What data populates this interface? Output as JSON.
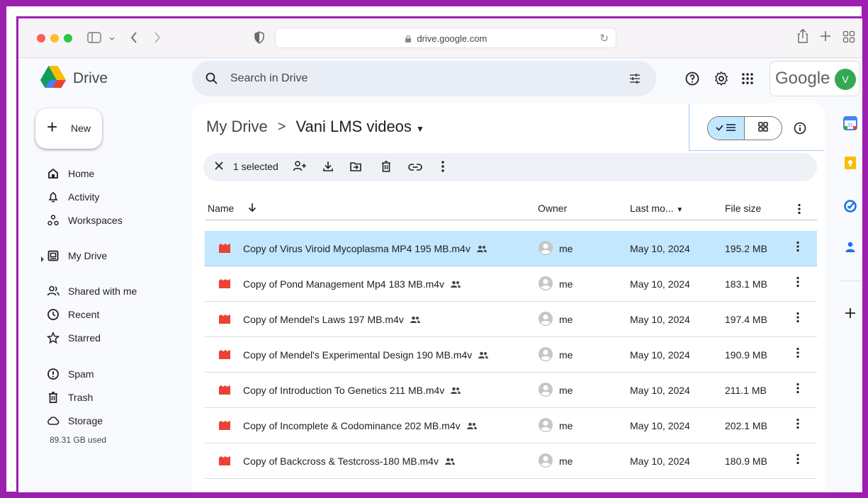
{
  "browser": {
    "url": "drive.google.com"
  },
  "app": {
    "name": "Drive",
    "brand": "Google",
    "avatar_letter": "V",
    "avatar_color": "#34a853"
  },
  "search": {
    "placeholder": "Search in Drive"
  },
  "sidebar": {
    "new_label": "New",
    "items": [
      {
        "label": "Home",
        "icon": "home-icon"
      },
      {
        "label": "Activity",
        "icon": "bell-icon"
      },
      {
        "label": "Workspaces",
        "icon": "workspaces-icon"
      },
      {
        "label": "My Drive",
        "icon": "my-drive-icon"
      },
      {
        "label": "Shared with me",
        "icon": "people-icon"
      },
      {
        "label": "Recent",
        "icon": "clock-icon"
      },
      {
        "label": "Starred",
        "icon": "star-icon"
      },
      {
        "label": "Spam",
        "icon": "spam-icon"
      },
      {
        "label": "Trash",
        "icon": "trash-icon"
      },
      {
        "label": "Storage",
        "icon": "cloud-icon"
      }
    ],
    "storage_used": "89.31 GB used"
  },
  "breadcrumb": {
    "root": "My Drive",
    "separator": ">",
    "current": "Vani LMS videos"
  },
  "actionbar": {
    "selected_label": "1 selected"
  },
  "table": {
    "columns": {
      "name": "Name",
      "owner": "Owner",
      "modified": "Last mo...",
      "size": "File size"
    },
    "rows": [
      {
        "name": "Copy of Virus Viroid Mycoplasma MP4 195 MB.m4v",
        "owner": "me",
        "modified": "May 10, 2024",
        "size": "195.2 MB",
        "selected": true
      },
      {
        "name": "Copy of Pond Management  Mp4 183 MB.m4v",
        "owner": "me",
        "modified": "May 10, 2024",
        "size": "183.1 MB",
        "selected": false
      },
      {
        "name": "Copy of Mendel's Laws 197 MB.m4v",
        "owner": "me",
        "modified": "May 10, 2024",
        "size": "197.4 MB",
        "selected": false
      },
      {
        "name": "Copy of Mendel's Experimental Design 190 MB.m4v",
        "owner": "me",
        "modified": "May 10, 2024",
        "size": "190.9 MB",
        "selected": false
      },
      {
        "name": "Copy of Introduction To Genetics 211 MB.m4v",
        "owner": "me",
        "modified": "May 10, 2024",
        "size": "211.1 MB",
        "selected": false
      },
      {
        "name": "Copy of Incomplete & Codominance 202  MB.m4v",
        "owner": "me",
        "modified": "May 10, 2024",
        "size": "202.1 MB",
        "selected": false
      },
      {
        "name": "Copy of Backcross & Testcross-180 MB.m4v",
        "owner": "me",
        "modified": "May 10, 2024",
        "size": "180.9 MB",
        "selected": false
      }
    ]
  },
  "colors": {
    "frame": "#9c1fb0",
    "selected_row": "#c2e7ff",
    "video_icon": "#ea4335"
  }
}
